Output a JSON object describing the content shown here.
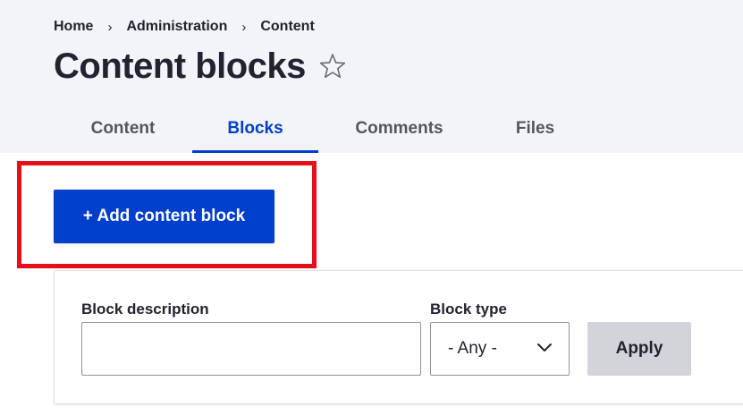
{
  "breadcrumb": {
    "items": [
      "Home",
      "Administration",
      "Content"
    ],
    "separator": "›"
  },
  "page": {
    "title": "Content blocks",
    "favorite_icon": "star-outline-icon"
  },
  "tabs": [
    {
      "label": "Content",
      "active": false
    },
    {
      "label": "Blocks",
      "active": true
    },
    {
      "label": "Comments",
      "active": false
    },
    {
      "label": "Files",
      "active": false
    }
  ],
  "actions": {
    "add_label": "+ Add content block"
  },
  "filters": {
    "description_label": "Block description",
    "description_value": "",
    "type_label": "Block type",
    "type_value": "- Any -",
    "apply_label": "Apply"
  },
  "colors": {
    "accent": "#003ecc",
    "highlight": "#e4111c",
    "header_bg": "#f3f4f9"
  }
}
